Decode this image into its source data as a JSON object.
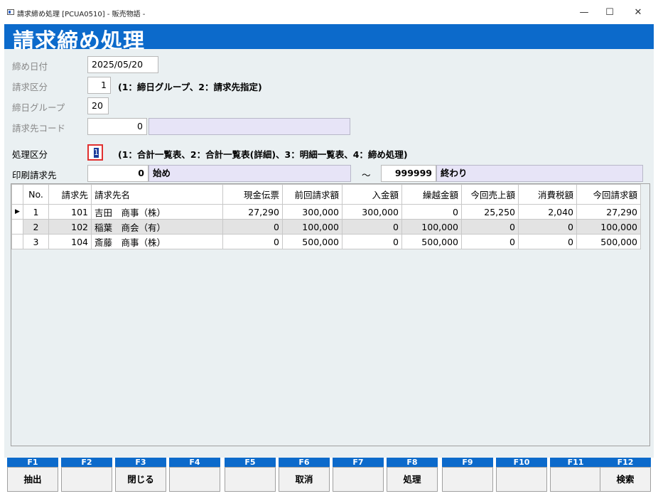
{
  "window": {
    "title": "請求締め処理 [PCUA0510] - 販売物語 -",
    "min": "—",
    "max": "☐",
    "close": "✕"
  },
  "banner": {
    "title": "請求締め処理"
  },
  "form": {
    "closing_date": {
      "label": "締め日付",
      "value": "2025/05/20"
    },
    "billing_type": {
      "label": "請求区分",
      "value": "1",
      "hint": "(1：締日グループ、2：請求先指定)"
    },
    "closing_group": {
      "label": "締日グループ",
      "value": "20"
    },
    "customer_code": {
      "label": "請求先コード",
      "value": "0",
      "name": ""
    },
    "process_type": {
      "label": "処理区分",
      "value": "1",
      "hint": "(1：合計一覧表、2：合計一覧表(詳細)、3：明細一覧表、4：締め処理)"
    },
    "print_range": {
      "label": "印刷請求先",
      "from_code": "0",
      "from_name": "始め",
      "tilde": "～",
      "to_code": "999999",
      "to_name": "終わり"
    }
  },
  "table": {
    "headers": [
      "No.",
      "請求先",
      "請求先名",
      "現金伝票",
      "前回請求額",
      "入金額",
      "繰越金額",
      "今回売上額",
      "消費税額",
      "今回請求額"
    ],
    "current_row_marker": "▶",
    "rows": [
      [
        "1",
        "101",
        "吉田　商事（株）",
        "27,290",
        "300,000",
        "300,000",
        "0",
        "25,250",
        "2,040",
        "27,290"
      ],
      [
        "2",
        "102",
        "稲葉　商会（有）",
        "0",
        "100,000",
        "0",
        "100,000",
        "0",
        "0",
        "100,000"
      ],
      [
        "3",
        "104",
        "斎藤　商事（株）",
        "0",
        "500,000",
        "0",
        "500,000",
        "0",
        "0",
        "500,000"
      ]
    ]
  },
  "function_keys": [
    {
      "key": "F1",
      "label": "抽出"
    },
    {
      "key": "F2",
      "label": ""
    },
    {
      "key": "F3",
      "label": "閉じる"
    },
    {
      "key": "F4",
      "label": ""
    },
    {
      "key": "F5",
      "label": ""
    },
    {
      "key": "F6",
      "label": "取消"
    },
    {
      "key": "F7",
      "label": ""
    },
    {
      "key": "F8",
      "label": "処理"
    },
    {
      "key": "F9",
      "label": ""
    },
    {
      "key": "F10",
      "label": ""
    },
    {
      "key": "F11",
      "label": ""
    },
    {
      "key": "F12",
      "label": "検索"
    }
  ],
  "colors": {
    "accent": "#0c6acb",
    "panel": "#eaf0f2",
    "name_field": "#e7e4f7"
  }
}
